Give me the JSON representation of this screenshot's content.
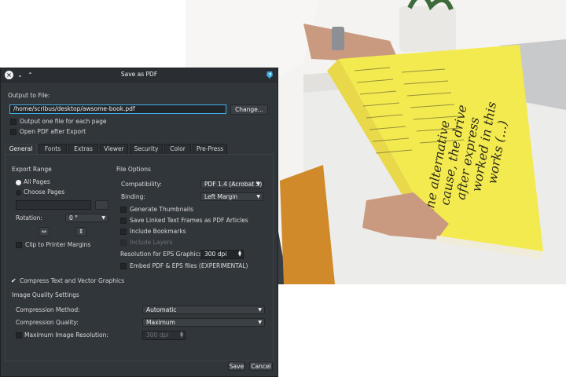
{
  "window": {
    "title": "Save as PDF"
  },
  "output": {
    "section_label": "Output to File:",
    "file_path": "/home/scribus/desktop/awsome-book.pdf",
    "change_button": "Change...",
    "one_file_per_page_label": "Output one file for each page",
    "open_after_export_label": "Open PDF after Export"
  },
  "tabs": [
    {
      "label": "General",
      "active": true
    },
    {
      "label": "Fonts"
    },
    {
      "label": "Extras"
    },
    {
      "label": "Viewer"
    },
    {
      "label": "Security"
    },
    {
      "label": "Color"
    },
    {
      "label": "Pre-Press"
    }
  ],
  "export_range": {
    "heading": "Export Range",
    "all_pages_label": "All Pages",
    "choose_pages_label": "Choose Pages",
    "rotation_label": "Rotation:",
    "rotation_value": "0 °",
    "clip_label": "Clip to Printer Margins"
  },
  "file_options": {
    "heading": "File Options",
    "compatibility_label": "Compatibility:",
    "compatibility_value": "PDF 1.4 (Acrobat 5)",
    "binding_label": "Binding:",
    "binding_value": "Left Margin",
    "generate_thumbnails_label": "Generate Thumbnails",
    "save_linked_label": "Save Linked Text Frames as PDF Articles",
    "include_bookmarks_label": "Include Bookmarks",
    "include_layers_label": "Include Layers",
    "eps_resolution_label": "Resolution for EPS Graphics:",
    "eps_resolution_value": "300 dpi",
    "embed_pdf_eps_label": "Embed PDF & EPS files (EXPERIMENTAL)"
  },
  "compress": {
    "label": "Compress Text and Vector Graphics",
    "checked": true
  },
  "image_quality": {
    "heading": "Image Quality Settings",
    "method_label": "Compression Method:",
    "method_value": "Automatic",
    "quality_label": "Compression Quality:",
    "quality_value": "Maximum",
    "max_res_label": "Maximum Image Resolution:",
    "max_res_value": "300 dpi"
  },
  "footer": {
    "save_button": "Save",
    "cancel_button": "Cancel"
  },
  "colors": {
    "dialog_bg": "#31363b",
    "accent": "#3daee9",
    "magazine_page": "#f3ea4f"
  },
  "icons": {
    "close": "close-icon",
    "minimize": "chevron-down-icon",
    "maximize": "chevron-up-icon",
    "app": "scribus-app-icon"
  }
}
